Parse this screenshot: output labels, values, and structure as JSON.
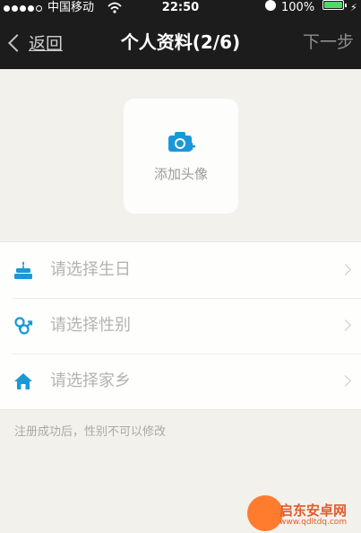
{
  "status_bar": {
    "carrier": "中国移动",
    "time": "22:50",
    "battery_percent": "100%",
    "battery_level": 1.0
  },
  "nav": {
    "back_label": "返回",
    "title": "个人资料(2/6)",
    "next_label": "下一步"
  },
  "avatar": {
    "label": "添加头像",
    "icon": "camera-add-icon"
  },
  "form": {
    "rows": [
      {
        "label": "请选择生日",
        "icon": "cake-icon"
      },
      {
        "label": "请选择性别",
        "icon": "gender-icon"
      },
      {
        "label": "请选择家乡",
        "icon": "home-icon"
      }
    ]
  },
  "note": "注册成功后，性别不可以修改",
  "watermark": {
    "title": "启东安卓网",
    "url": "www.qdltdq.com"
  },
  "colors": {
    "accent": "#1a98d8",
    "nav_background": "#1c1c1c",
    "page_background": "#f2f1ec",
    "battery": "#4cd964"
  }
}
